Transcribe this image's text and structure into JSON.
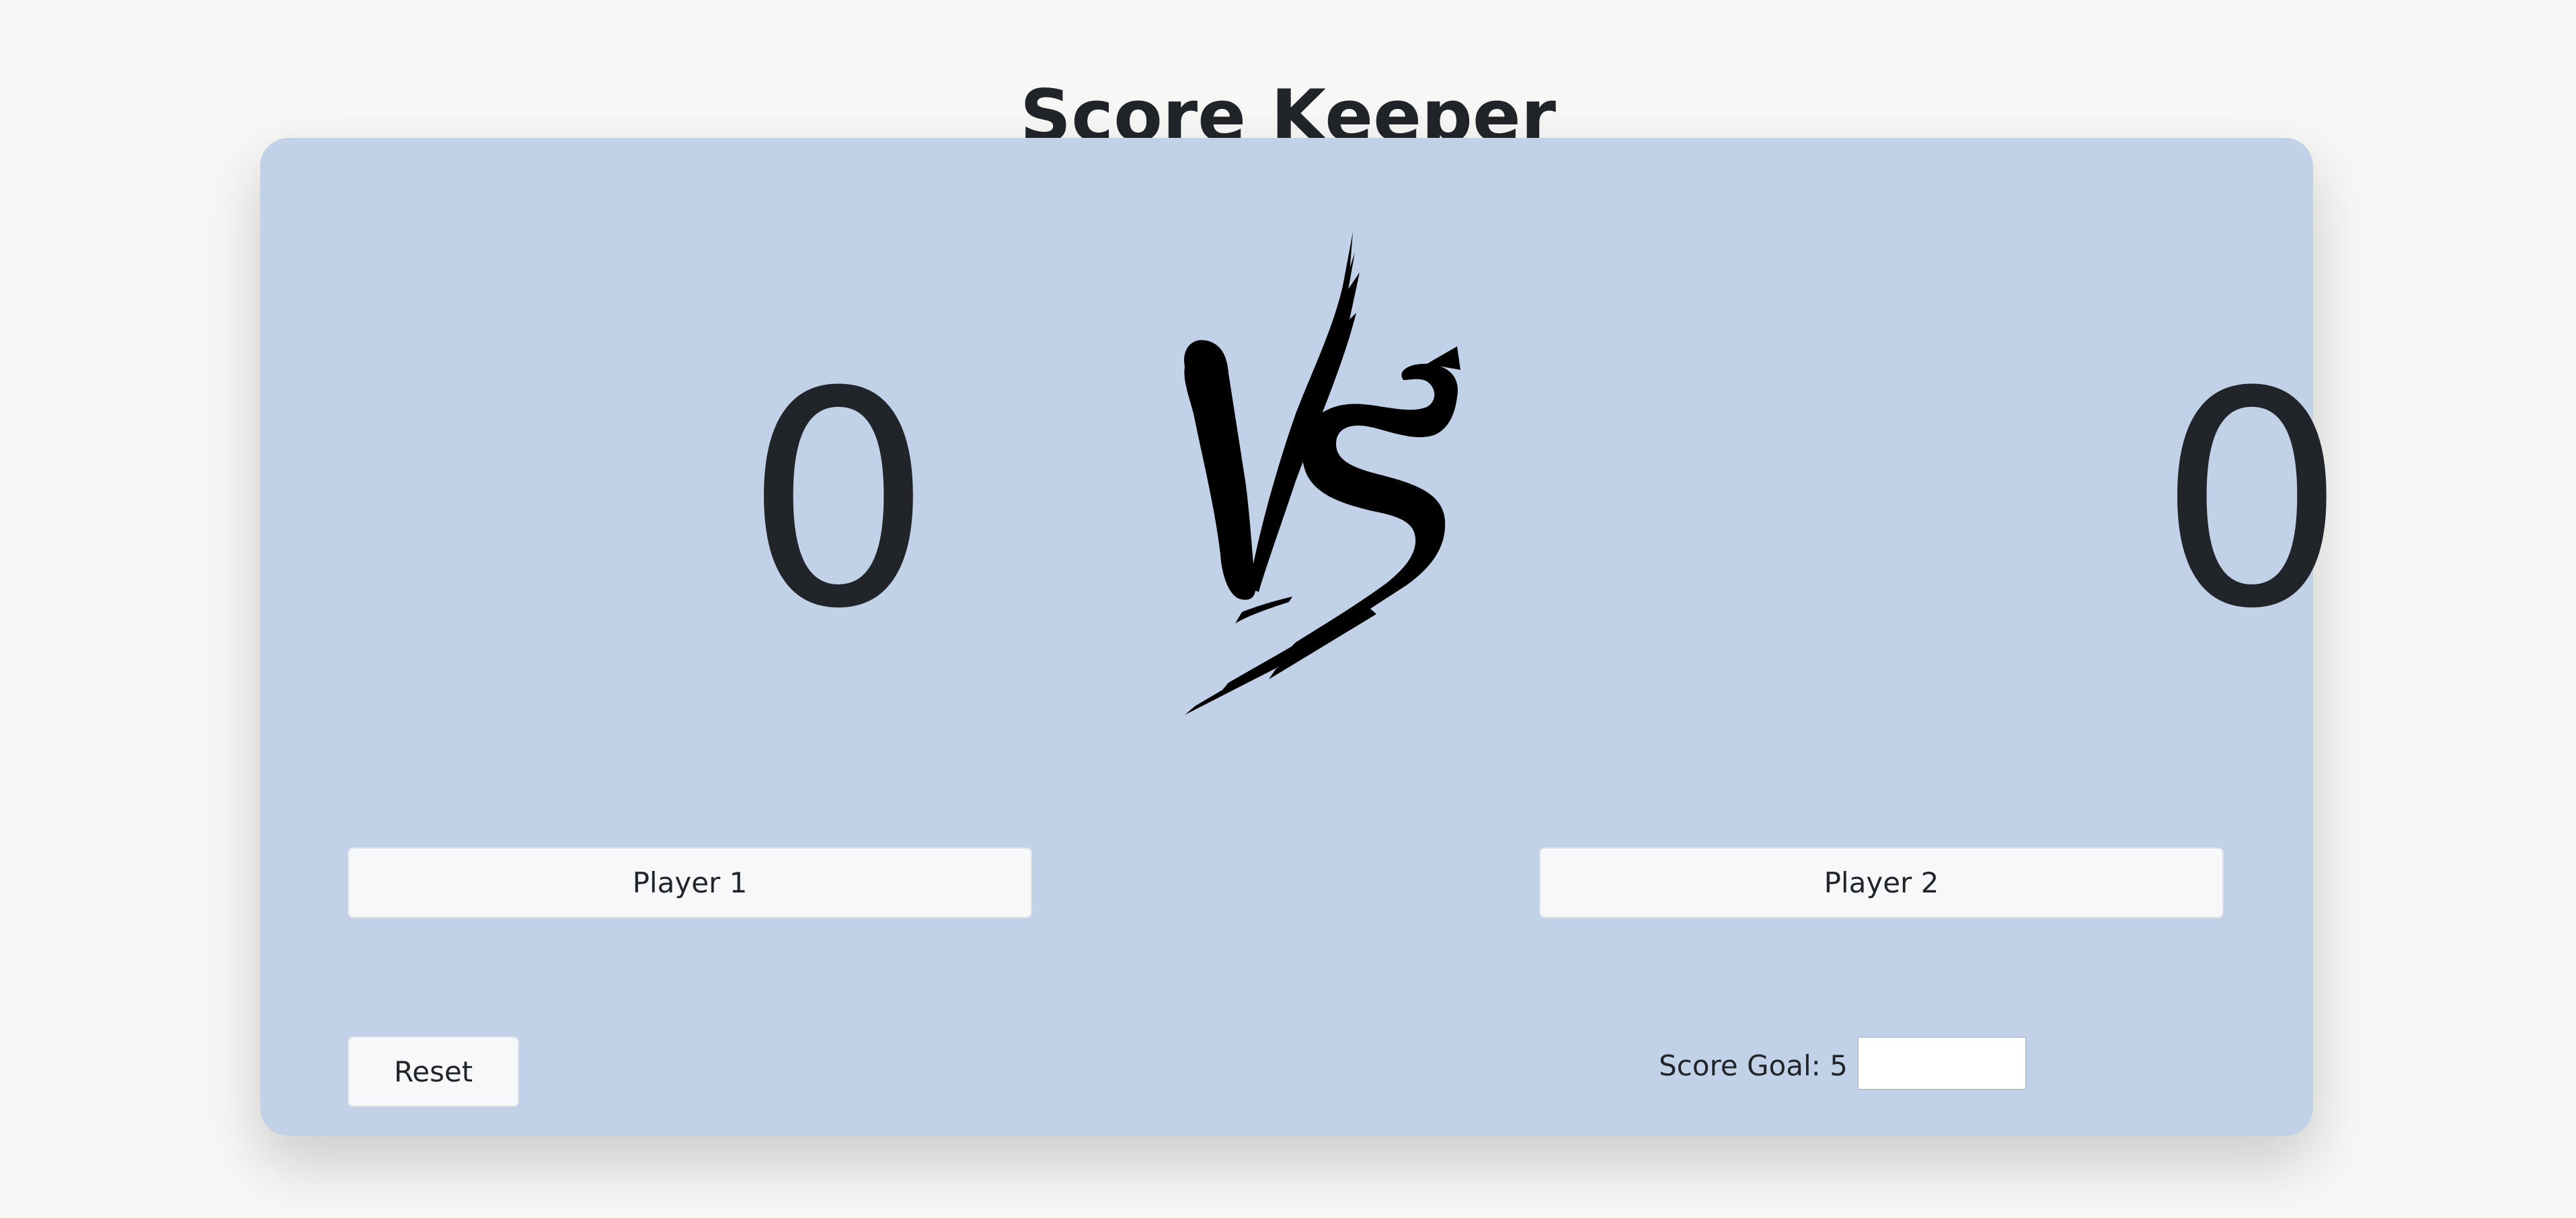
{
  "app": {
    "title": "Score Keeper"
  },
  "scoreboard": {
    "player1_score": "0",
    "player2_score": "0",
    "versus_graphic": "vs-brush-logo"
  },
  "controls": {
    "player1_button": "Player 1",
    "player2_button": "Player 2",
    "reset_button": "Reset",
    "score_goal_label": "Score Goal: 5",
    "score_goal_input_value": ""
  },
  "colors": {
    "page_background": "#f7f7f6",
    "card_background": "#c1d2e8",
    "button_background": "#f7f8fa",
    "text": "#212529"
  }
}
